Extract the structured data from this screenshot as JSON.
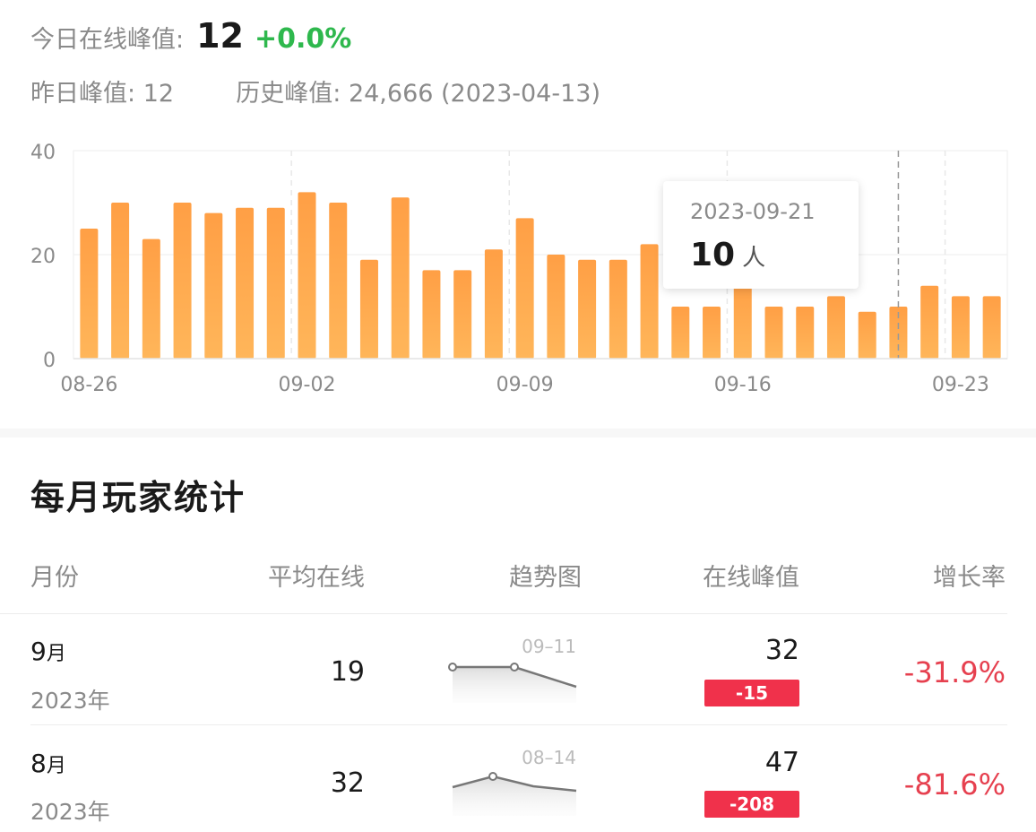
{
  "summary": {
    "today_label": "今日在线峰值:",
    "today_value": "12",
    "today_change": "+0.0%",
    "yesterday_label": "昨日峰值:",
    "yesterday_value": "12",
    "history_label": "历史峰值:",
    "history_value": "24,666 (2023-04-13)"
  },
  "chart_data": {
    "type": "bar",
    "categories": [
      "08-26",
      "08-27",
      "08-28",
      "08-29",
      "08-30",
      "08-31",
      "09-01",
      "09-02",
      "09-03",
      "09-04",
      "09-05",
      "09-06",
      "09-07",
      "09-08",
      "09-09",
      "09-10",
      "09-11",
      "09-12",
      "09-13",
      "09-14",
      "09-15",
      "09-16",
      "09-17",
      "09-18",
      "09-19",
      "09-20",
      "09-21",
      "09-22",
      "09-23",
      "09-24"
    ],
    "values": [
      25,
      30,
      23,
      30,
      28,
      29,
      29,
      32,
      30,
      19,
      31,
      17,
      17,
      21,
      27,
      20,
      19,
      19,
      22,
      10,
      10,
      15,
      10,
      10,
      12,
      9,
      10,
      14,
      12,
      12
    ],
    "x_tick_labels": [
      "08-26",
      "09-02",
      "09-09",
      "09-16",
      "09-23"
    ],
    "y_ticks": [
      "0",
      "20",
      "40"
    ],
    "ylim": [
      0,
      40
    ],
    "grid": true,
    "bar_color": "#ffa64a",
    "highlight_category": "09-21",
    "tooltip": {
      "date": "2023-09-21",
      "value": "10",
      "unit": "人"
    }
  },
  "monthly": {
    "title": "每月玩家统计",
    "headers": {
      "month": "月份",
      "avg": "平均在线",
      "trend": "趋势图",
      "peak": "在线峰值",
      "growth": "增长率"
    },
    "rows": [
      {
        "month": "9",
        "month_unit": "月",
        "year": "2023年",
        "avg": "19",
        "trend_label": "09–11",
        "peak": "32",
        "peak_change": "-15",
        "growth": "-31.9%"
      },
      {
        "month": "8",
        "month_unit": "月",
        "year": "2023年",
        "avg": "32",
        "trend_label": "08–14",
        "peak": "47",
        "peak_change": "-208",
        "growth": "-81.6%"
      }
    ]
  },
  "colors": {
    "positive": "#2eb84d",
    "negative": "#e6404f",
    "badge": "#f0314b"
  }
}
